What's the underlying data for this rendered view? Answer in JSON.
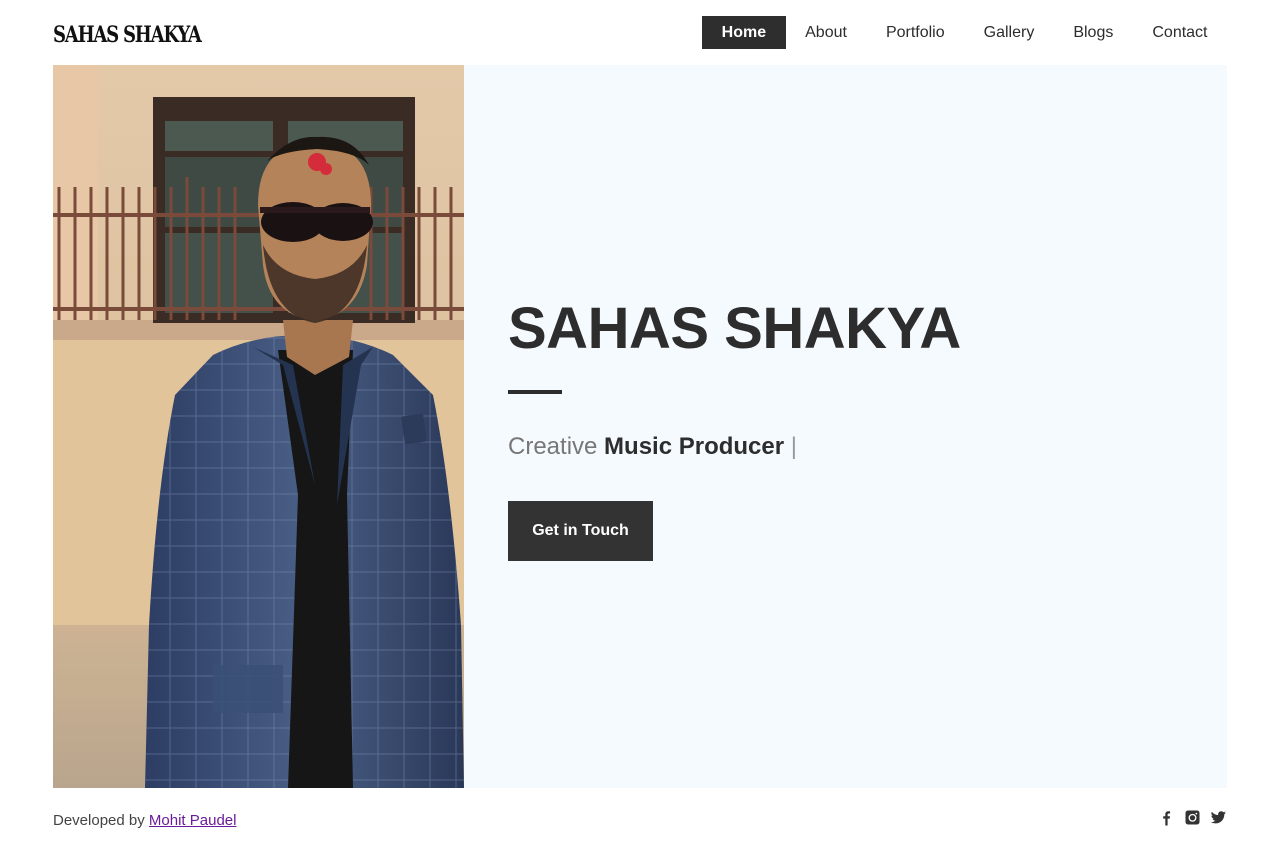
{
  "header": {
    "logo": "SAHAS SHAKYA",
    "nav": [
      {
        "label": "Home",
        "active": true
      },
      {
        "label": "About",
        "active": false
      },
      {
        "label": "Portfolio",
        "active": false
      },
      {
        "label": "Gallery",
        "active": false
      },
      {
        "label": "Blogs",
        "active": false
      },
      {
        "label": "Contact",
        "active": false
      }
    ]
  },
  "hero": {
    "name": "SAHAS SHAKYA",
    "tagline_prefix": "Creative ",
    "tagline_role": "Music Producer",
    "tagline_cursor": " |",
    "cta_label": "Get in Touch"
  },
  "footer": {
    "credit_prefix": "Developed by ",
    "credit_author": "Mohit Paudel"
  },
  "socials": [
    "facebook-icon",
    "instagram-icon",
    "twitter-icon"
  ],
  "colors": {
    "accent_dark": "#2e2e2e",
    "hero_background": "#f5faff",
    "link": "#6a1b9a"
  }
}
